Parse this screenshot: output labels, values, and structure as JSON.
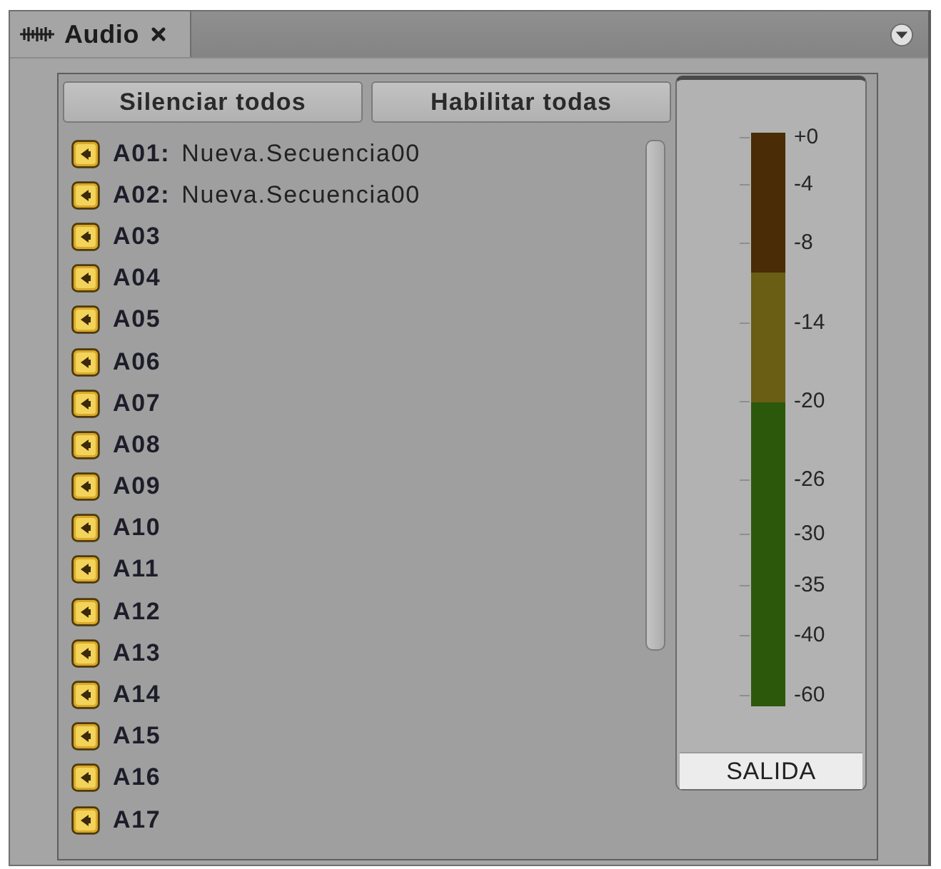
{
  "tabs": [
    {
      "label": "Audio",
      "selected": true
    }
  ],
  "buttons": [
    "Silenciar todos",
    "Habilitar todas"
  ],
  "tracks": [
    {
      "label": "A01:",
      "sequence": "Nueva.Secuencia00"
    },
    {
      "label": "A02:",
      "sequence": "Nueva.Secuencia00"
    },
    {
      "label": "A03"
    },
    {
      "label": "A04"
    },
    {
      "label": "A05"
    },
    {
      "label": "A06"
    },
    {
      "label": "A07"
    },
    {
      "label": "A08"
    },
    {
      "label": "A09"
    },
    {
      "label": "A10"
    },
    {
      "label": "A11"
    },
    {
      "label": "A12"
    },
    {
      "label": "A13"
    },
    {
      "label": "A14"
    },
    {
      "label": "A15"
    },
    {
      "label": "A16"
    },
    {
      "label": "A17"
    }
  ],
  "meter": {
    "scale": [
      "+0",
      "-4",
      "-8",
      "-14",
      "-20",
      "-26",
      "-30",
      "-35",
      "-40",
      "-60"
    ],
    "label": "SALIDA"
  }
}
